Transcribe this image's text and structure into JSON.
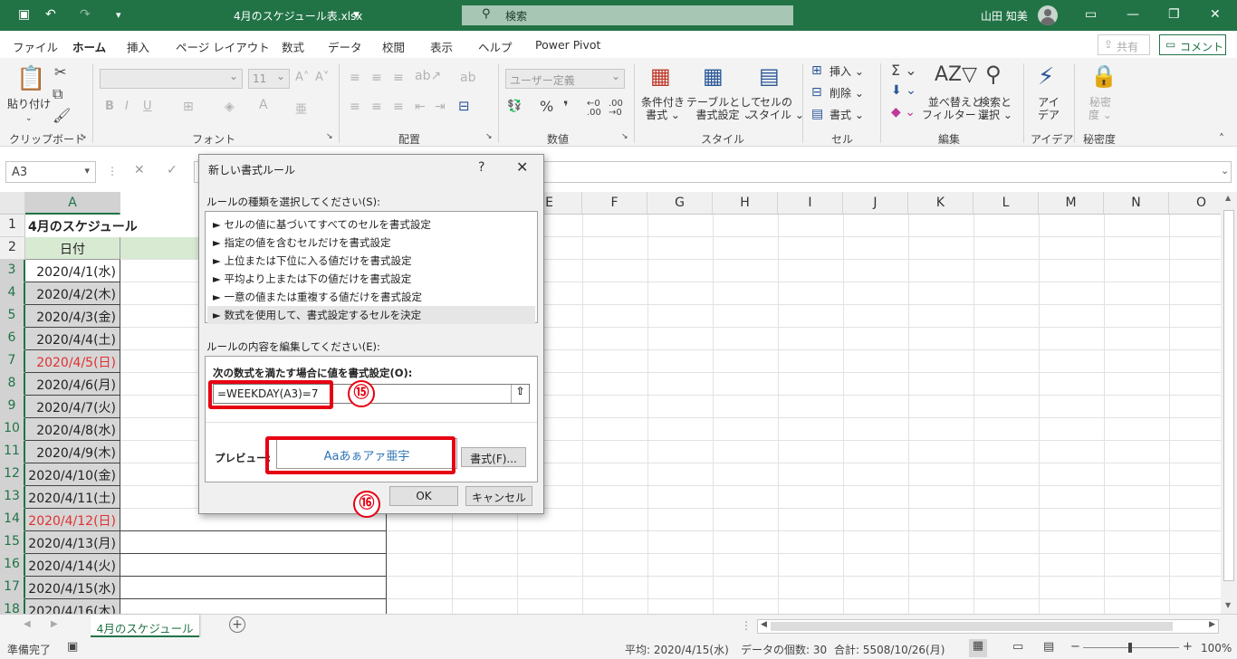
{
  "titlebar": {
    "doc_title": "4月のスケジュール表.xlsx",
    "search": "検索",
    "user": "山田 知美"
  },
  "tabs": [
    "ファイル",
    "ホーム",
    "挿入",
    "ページ レイアウト",
    "数式",
    "データ",
    "校閲",
    "表示",
    "ヘルプ",
    "Power Pivot"
  ],
  "share": "共有",
  "comment": "コメント",
  "ribbon": {
    "paste": "貼り付け",
    "font_size": "11",
    "number_format": "ユーザー定義",
    "cond_format": "条件付き",
    "cond_format2": "書式",
    "table_format": "テーブルとして",
    "table_format2": "書式設定",
    "cell_style": "セルの",
    "cell_style2": "スタイル",
    "insert": "挿入",
    "delete": "削除",
    "format": "書式",
    "sort": "並べ替えと",
    "sort2": "フィルター",
    "find": "検索と",
    "find2": "選択",
    "ideas": "アイ",
    "ideas2": "デア",
    "sensitivity": "秘密",
    "sensitivity2": "度",
    "groups": {
      "clipboard": "クリップボード",
      "font": "フォント",
      "align": "配置",
      "number": "数値",
      "style": "スタイル",
      "cells": "セル",
      "edit": "編集",
      "ideas": "アイデア",
      "sensitivity": "秘密度"
    }
  },
  "namebox": "A3",
  "columns": [
    "A",
    "E",
    "F",
    "G",
    "H",
    "I",
    "J",
    "K",
    "L",
    "M",
    "N",
    "O"
  ],
  "rows": [
    {
      "n": "1",
      "a": "4月のスケジュール"
    },
    {
      "n": "2",
      "a": "日付"
    },
    {
      "n": "3",
      "a": "2020/4/1(水)"
    },
    {
      "n": "4",
      "a": "2020/4/2(木)"
    },
    {
      "n": "5",
      "a": "2020/4/3(金)"
    },
    {
      "n": "6",
      "a": "2020/4/4(土)"
    },
    {
      "n": "7",
      "a": "2020/4/5(日)"
    },
    {
      "n": "8",
      "a": "2020/4/6(月)"
    },
    {
      "n": "9",
      "a": "2020/4/7(火)"
    },
    {
      "n": "10",
      "a": "2020/4/8(水)"
    },
    {
      "n": "11",
      "a": "2020/4/9(木)"
    },
    {
      "n": "12",
      "a": "2020/4/10(金)"
    },
    {
      "n": "13",
      "a": "2020/4/11(土)"
    },
    {
      "n": "14",
      "a": "2020/4/12(日)"
    },
    {
      "n": "15",
      "a": "2020/4/13(月)"
    },
    {
      "n": "16",
      "a": "2020/4/14(火)"
    },
    {
      "n": "17",
      "a": "2020/4/15(水)"
    },
    {
      "n": "18",
      "a": "2020/4/16(木)"
    }
  ],
  "sheet_tab": "4月のスケジュール",
  "status": {
    "ready": "準備完了",
    "avg": "平均: 2020/4/15(水)",
    "count": "データの個数: 30",
    "sum": "合計: 5508/10/26(月)",
    "zoom": "100%"
  },
  "dialog": {
    "title": "新しい書式ルール",
    "help": "?",
    "select_label": "ルールの種類を選択してください(S):",
    "rule_types": [
      "► セルの値に基づいてすべてのセルを書式設定",
      "► 指定の値を含むセルだけを書式設定",
      "► 上位または下位に入る値だけを書式設定",
      "► 平均より上または下の値だけを書式設定",
      "► 一意の値または重複する値だけを書式設定",
      "► 数式を使用して、書式設定するセルを決定"
    ],
    "edit_label": "ルールの内容を編集してください(E):",
    "formula_label": "次の数式を満たす場合に値を書式設定(O):",
    "formula": "=WEEKDAY(A3)=7",
    "preview_label": "プレビュー:",
    "preview_text": "Aaあぁアァ亜宇",
    "format_button": "書式(F)...",
    "ok": "OK",
    "cancel": "キャンセル"
  },
  "annotations": {
    "step15": "⑮",
    "step16": "⑯"
  },
  "colors": {
    "accent": "#217346",
    "highlight": "#e60012",
    "sunday": "#e03030",
    "preview": "#2e74b5"
  }
}
